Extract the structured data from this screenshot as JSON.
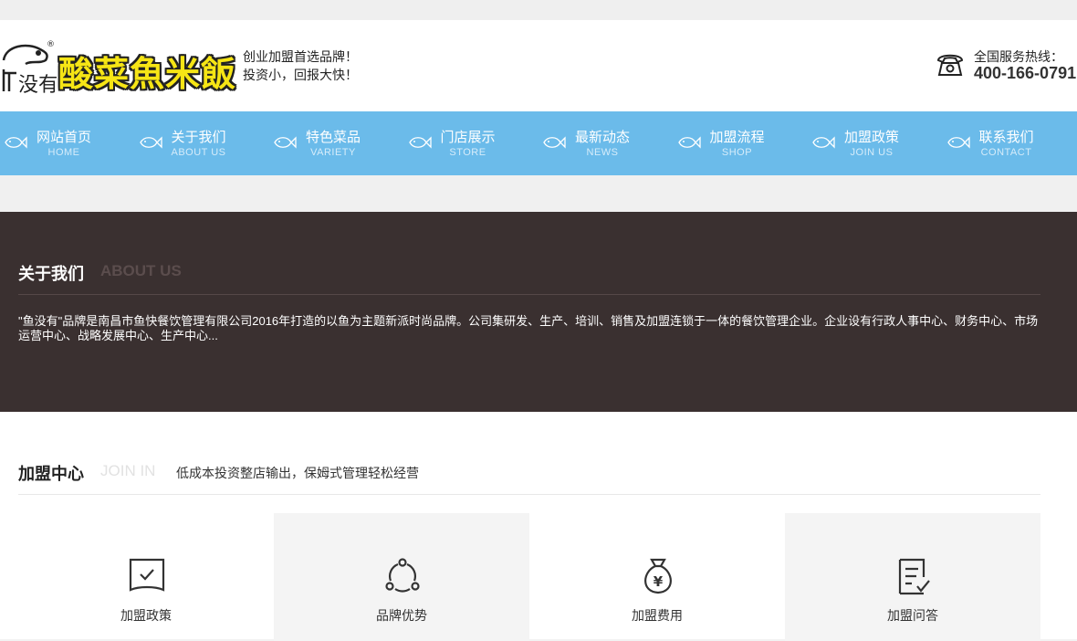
{
  "brand": {
    "logo_text": "酸菜魚米飯",
    "logo_mark_text": "没有",
    "registered": "®",
    "slogan_line1": "创业加盟首选品牌！",
    "slogan_line2": "投资小，回报大快！"
  },
  "hotline": {
    "label": "全国服务热线：",
    "number": "400-166-0791"
  },
  "nav": {
    "items": [
      {
        "cn": "网站首页",
        "en": "HOME"
      },
      {
        "cn": "关于我们",
        "en": "ABOUT US"
      },
      {
        "cn": "特色菜品",
        "en": "VARIETY"
      },
      {
        "cn": "门店展示",
        "en": "STORE"
      },
      {
        "cn": "最新动态",
        "en": "NEWS"
      },
      {
        "cn": "加盟流程",
        "en": "SHOP"
      },
      {
        "cn": "加盟政策",
        "en": "JOIN US"
      },
      {
        "cn": "联系我们",
        "en": "CONTACT"
      }
    ]
  },
  "about": {
    "title": "关于我们",
    "title_en": "ABOUT US",
    "text": "\"鱼没有\"品牌是南昌市鱼快餐饮管理有限公司2016年打造的以鱼为主题新派时尚品牌。公司集研发、生产、培训、销售及加盟连锁于一体的餐饮管理企业。企业设有行政人事中心、财务中心、市场运营中心、战略发展中心、生产中心..."
  },
  "join": {
    "title": "加盟中心",
    "title_en": "JOIN IN",
    "subtitle": "低成本投资整店输出，保姆式管理轻松经营",
    "cards": [
      {
        "label": "加盟政策",
        "icon": "shield-check-icon"
      },
      {
        "label": "品牌优势",
        "icon": "network-cycle-icon"
      },
      {
        "label": "加盟费用",
        "icon": "money-bag-icon"
      },
      {
        "label": "加盟问答",
        "icon": "checklist-icon"
      }
    ]
  },
  "colors": {
    "nav_bg": "#6bbbea",
    "about_bg": "#3a3030",
    "logo_yellow": "#f6e515"
  }
}
